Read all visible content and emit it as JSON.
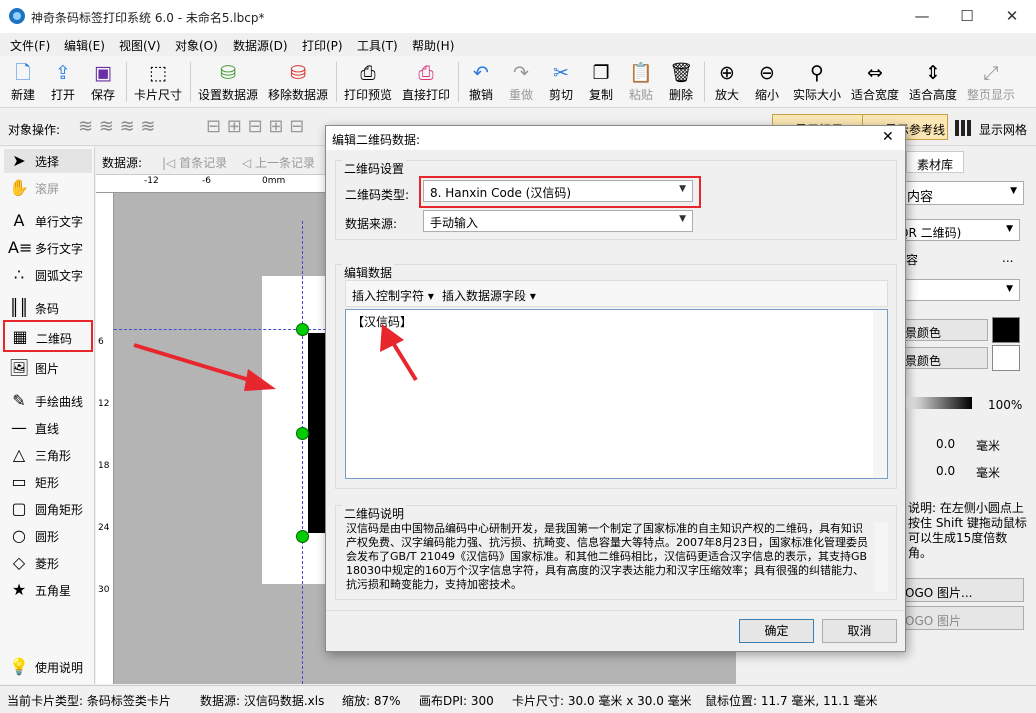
{
  "titlebar": {
    "title": "神奇条码标签打印系统 6.0 - 未命名5.lbcp*",
    "min": "—",
    "max": "☐",
    "close": "✕"
  },
  "menu": [
    "文件(F)",
    "编辑(E)",
    "视图(V)",
    "对象(O)",
    "数据源(D)",
    "打印(P)",
    "工具(T)",
    "帮助(H)"
  ],
  "toolbar": {
    "new": "新建",
    "open": "打开",
    "save": "保存",
    "card_size": "卡片尺寸",
    "set_datasource": "设置数据源",
    "remove_datasource": "移除数据源",
    "print_preview": "打印预览",
    "direct_print": "直接打印",
    "undo": "撤销",
    "redo": "重做",
    "cut": "剪切",
    "copy": "复制",
    "paste": "粘贴",
    "delete": "删除",
    "zoom_in": "放大",
    "zoom_out": "缩小",
    "actual_size": "实际大小",
    "fit_width": "适合宽度",
    "fit_height": "适合高度",
    "full_page": "整页显示"
  },
  "objbar": {
    "label": "对象操作:",
    "show_label": "显示标尺",
    "show_guides": "显示参考线",
    "show_grid": "显示网格"
  },
  "tools": {
    "select": "选择",
    "scroll": "滚屏",
    "single_text": "单行文字",
    "multi_text": "多行文字",
    "arc_text": "圆弧文字",
    "barcode": "条码",
    "qrcode": "二维码",
    "image": "图片",
    "freehand": "手绘曲线",
    "line": "直线",
    "triangle": "三角形",
    "rect": "矩形",
    "round_rect": "圆角矩形",
    "circle": "圆形",
    "diamond": "菱形",
    "star": "五角星",
    "help": "使用说明"
  },
  "datasource_bar": {
    "label": "数据源:",
    "first": "首条记录",
    "prev": "上一条记录"
  },
  "ruler": {
    "h": [
      "-12",
      "-6",
      "0mm"
    ],
    "v": [
      "6",
      "12",
      "18",
      "24",
      "30"
    ]
  },
  "right": {
    "tab_material": "素材库",
    "content": "内容",
    "qr_type": "QR 二维码)",
    "hint_dots": "容",
    "bg_color": "景颜色",
    "fg_color": "景颜色",
    "opacity": "100%",
    "x_val": "0.0",
    "y_val": "0.0",
    "unit": "毫米",
    "help": "说明: 在左侧小圆点上按住 Shift 键拖动鼠标可以生成15度倍数角。",
    "logo_btn1": "OGO 图片...",
    "logo_btn2": "OGO 图片"
  },
  "dialog": {
    "title": "编辑二维码数据:",
    "close": "✕",
    "settings_group": "二维码设置",
    "type_label": "二维码类型:",
    "type_value": "8. Hanxin Code (汉信码)",
    "source_label": "数据来源:",
    "source_value": "手动输入",
    "edit_group": "编辑数据",
    "insert_ctrl": "插入控制字符",
    "insert_field": "插入数据源字段",
    "data_text": "【汉信码】",
    "desc_group": "二维码说明",
    "desc_text": "汉信码是由中国物品编码中心研制开发，是我国第一个制定了国家标准的自主知识产权的二维码，具有知识产权免费、汉字编码能力强、抗污损、抗畸变、信息容量大等特点。2007年8月23日，国家标准化管理委员会发布了GB/T 21049《汉信码》国家标准。和其他二维码相比，汉信码更适合汉字信息的表示，其支持GB 18030中规定的160万个汉字信息字符，具有高度的汉字表达能力和汉字压缩效率；具有很强的纠错能力、抗污损和畸变能力，支持加密技术。",
    "ok": "确定",
    "cancel": "取消"
  },
  "status": {
    "card_type": "当前卡片类型: 条码标签类卡片",
    "datasource": "数据源: 汉信码数据.xls",
    "zoom": "缩放: 87%",
    "dpi": "画布DPI: 300",
    "card_size": "卡片尺寸: 30.0 毫米 x 30.0 毫米",
    "mouse": "鼠标位置: 11.7 毫米, 11.1 毫米"
  },
  "colors": {
    "accent": "#e8262d",
    "selection": "#00cc00",
    "title_bg": "#ffffff"
  }
}
